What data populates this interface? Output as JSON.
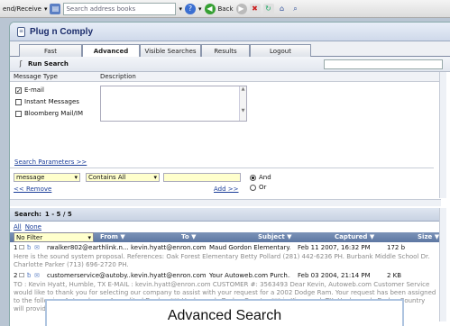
{
  "toolbar": {
    "send_receive": "end/Receive",
    "search_placeholder": "Search address books",
    "back": "Back"
  },
  "app": {
    "title": "Plug n Comply"
  },
  "tabs": [
    "Fast",
    "Advanced",
    "Visible Searches",
    "Results",
    "Logout"
  ],
  "run_search": "Run Search",
  "criteria": {
    "message_type_header": "Message Type",
    "description_header": "Description",
    "types": [
      {
        "label": "E-mail",
        "checked": true
      },
      {
        "label": "Instant Messages",
        "checked": false
      },
      {
        "label": "Bloomberg Mail/IM",
        "checked": false
      }
    ],
    "search_parameters_link": "Search Parameters >>",
    "field_select": "message",
    "operator_select": "Contains All",
    "value": "",
    "and_label": "And",
    "or_label": "Or",
    "logic": "And",
    "remove_link": "<< Remove",
    "add_link": "Add >>"
  },
  "results": {
    "label": "Search:",
    "range": "1 - 5 / 5",
    "all_link": "All",
    "none_link": "None",
    "filter": "No Filter",
    "columns": [
      "From",
      "To",
      "Subject",
      "Captured",
      "Size"
    ],
    "rows": [
      {
        "num": "1",
        "from": "rwalker802@earthlink.n...",
        "to": "kevin.hyatt@enron.com",
        "subject": "Maud Gordon Elementary...",
        "captured": "Feb 11 2007, 16:32 PM",
        "size": "172 b",
        "snippet": "Here is the sound system proposal. References: Oak Forest Elementary Betty Pollard (281) 442-6236 PH. Burbank Middle School Dr. Charlotte Parker (713) 696-2720 PH."
      },
      {
        "num": "2",
        "from": "customerservice@autoby...",
        "to": "kevin.hyatt@enron.com",
        "subject": "Your Autoweb.com Purch...",
        "captured": "Feb 03 2004, 21:14 PM",
        "size": "2 KB",
        "snippet": "TO : Kevin Hyatt, Humble, TX E-MAIL : kevin.hyatt@enron.com CUSTOMER #: 3563493 Dear Kevin, Autoweb.com Customer Service would like to thank you for selecting our company to assist with your request for a 2002 Dodge Ram. Your request has been assigned to the following Autoweb.com Accredited Dealer: *** Hazlewoods Dodge Country *** in Kingwood, TX. Hazlewoods Dodge Country will provide you with a pleasant buying experience and a prompt price. The trained Autoweb.com Manager at H..."
      }
    ]
  },
  "caption": "Advanced Search"
}
